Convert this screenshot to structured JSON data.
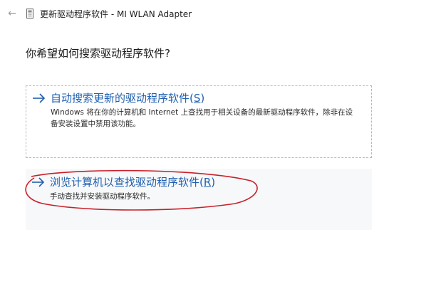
{
  "window": {
    "title": "更新驱动程序软件 - MI WLAN Adapter",
    "back_glyph": "←"
  },
  "heading": "你希望如何搜索驱动程序软件?",
  "options": [
    {
      "title": "自动搜索更新的驱动程序软件(",
      "mnemonic": "S",
      "title_end": ")",
      "description": "Windows 将在你的计算机和 Internet 上查找用于相关设备的最新驱动程序软件，除非在设备安装设置中禁用该功能。"
    },
    {
      "title": "浏览计算机以查找驱动程序软件(",
      "mnemonic": "R",
      "title_end": ")",
      "description": "手动查找并安装驱动程序软件。"
    }
  ],
  "colors": {
    "link_blue": "#1f5fb0",
    "annotation_red": "#c8202a",
    "border_gray": "#b8b8b8"
  },
  "icons": {
    "back": "back-arrow-icon",
    "device": "device-icon",
    "option_arrow": "right-arrow-icon"
  }
}
